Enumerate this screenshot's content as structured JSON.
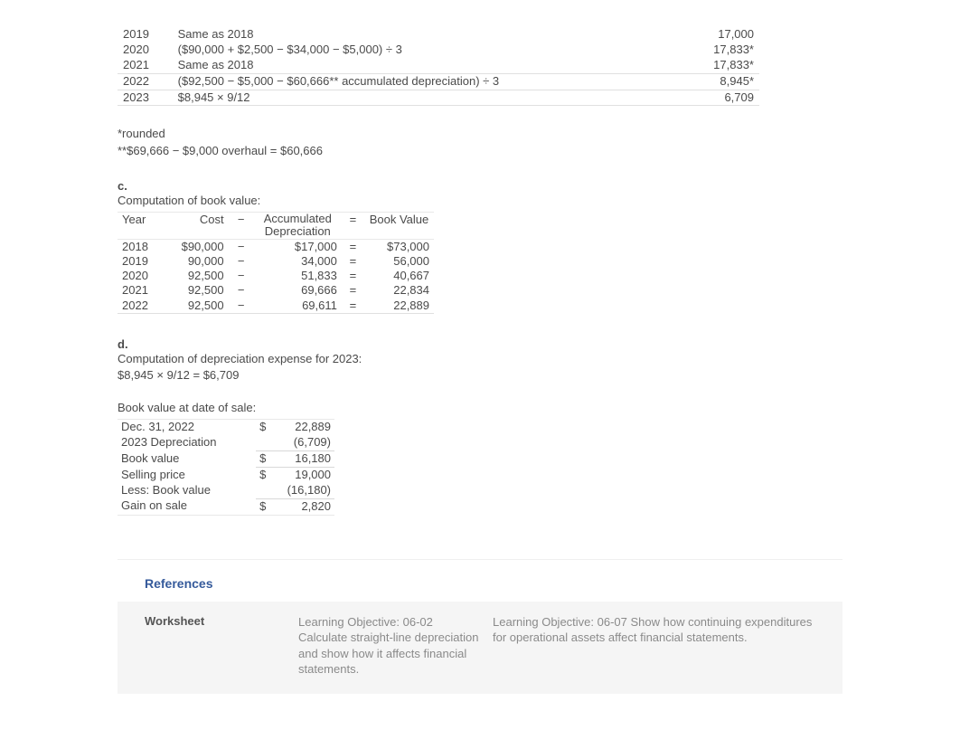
{
  "dep_rows_top": [
    {
      "year": "2019",
      "desc": "Same as 2018",
      "value": "17,000"
    },
    {
      "year": "2020",
      "desc": "($90,000 + $2,500 − $34,000 − $5,000) ÷ 3",
      "value": "17,833*"
    },
    {
      "year": "2021",
      "desc": "Same as 2018",
      "value": "17,833*"
    }
  ],
  "dep_rows_bottom": [
    {
      "year": "2022",
      "desc": "($92,500 − $5,000 − $60,666** accumulated depreciation) ÷ 3",
      "value": "8,945*"
    },
    {
      "year": "2023",
      "desc": "$8,945 × 9/12",
      "value": "6,709"
    }
  ],
  "footnotes": {
    "a": "*rounded",
    "b": "**$69,666 − $9,000 overhaul = $60,666"
  },
  "section_c": {
    "label": "c.",
    "title": "Computation of book value:",
    "headers": {
      "year": "Year",
      "cost": "Cost",
      "minus": "−",
      "acc": "Accumulated Depreciation",
      "eq": "=",
      "bv": "Book Value"
    },
    "rows": [
      {
        "year": "2018",
        "cost": "$90,000",
        "acc": "$17,000",
        "bv": "$73,000"
      },
      {
        "year": "2019",
        "cost": "90,000",
        "acc": "34,000",
        "bv": "56,000"
      },
      {
        "year": "2020",
        "cost": "92,500",
        "acc": "51,833",
        "bv": "40,667"
      },
      {
        "year": "2021",
        "cost": "92,500",
        "acc": "69,666",
        "bv": "22,834"
      },
      {
        "year": "2022",
        "cost": "92,500",
        "acc": "69,611",
        "bv": "22,889"
      }
    ]
  },
  "section_d": {
    "label": "d.",
    "title": "Computation of depreciation expense for 2023:",
    "calc": "$8,945 × 9/12 = $6,709",
    "bv_title": "Book value at date of sale:",
    "rows": [
      {
        "lbl": "Dec. 31, 2022",
        "d": "$",
        "a": "22,889",
        "rule": false,
        "top": true
      },
      {
        "lbl": "2023 Depreciation",
        "d": "",
        "a": "(6,709)",
        "rule": false
      },
      {
        "lbl": "Book value",
        "d": "$",
        "a": "16,180",
        "rule": true
      },
      {
        "lbl": "Selling price",
        "d": "$",
        "a": "19,000",
        "rule": true
      },
      {
        "lbl": "Less: Book value",
        "d": "",
        "a": "(16,180)",
        "rule": false
      },
      {
        "lbl": "Gain on sale",
        "d": "$",
        "a": "2,820",
        "rule": true,
        "bot": true
      }
    ]
  },
  "references": {
    "title": "References",
    "col1": "Worksheet",
    "col2": "Learning Objective: 06-02 Calculate straight-line depreciation and show how it affects financial statements.",
    "col3": "Learning Objective: 06-07 Show how continuing expenditures for operational assets affect financial statements."
  }
}
